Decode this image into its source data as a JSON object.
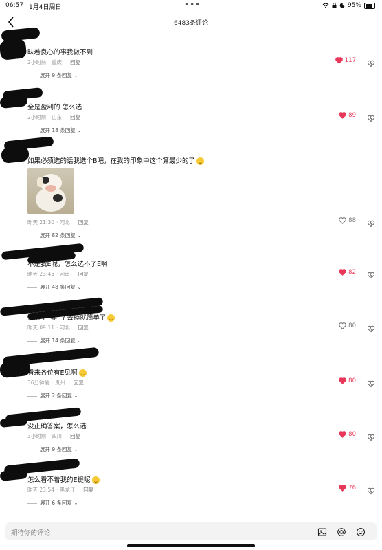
{
  "status": {
    "time": "06:57",
    "date": "1月4日周日",
    "battery": "95%"
  },
  "header": {
    "title": "6483条评论"
  },
  "comments": [
    {
      "text": "昧着良心的事我做不到",
      "time": "2小时前",
      "loc": "重庆",
      "reply": "回复",
      "likes": "117",
      "liked": true,
      "expand": "展开 9 条回复"
    },
    {
      "text": "全是盈利的 怎么选",
      "time": "2小时前",
      "loc": "山东",
      "reply": "回复",
      "likes": "89",
      "liked": true,
      "expand": "展开 18 条回复"
    },
    {
      "text": "如果必须选的话我选个B吧，在我的印象中这个算最少的了",
      "time": "昨天 21:30",
      "loc": "河北",
      "reply": "回复",
      "likes": "88",
      "liked": false,
      "expand": "展开 82 条回复"
    },
    {
      "text": "不是我E呢，怎么选不了E啊",
      "time": "昨天 23:45",
      "loc": "河南",
      "reply": "回复",
      "likes": "82",
      "liked": true,
      "expand": "展开 48 条回复"
    },
    {
      "text": "把那个“非”字去掉就简单了",
      "time": "昨天 09:11",
      "loc": "河北",
      "reply": "回复",
      "likes": "80",
      "liked": false,
      "expand": "展开 14 条回复"
    },
    {
      "text": "看来各位有E见啊",
      "time": "36分钟前",
      "loc": "贵州",
      "reply": "回复",
      "likes": "80",
      "liked": true,
      "expand": "展开 2 条回复"
    },
    {
      "text": "没正确答案，怎么选",
      "time": "3小时前",
      "loc": "四川",
      "reply": "回复",
      "likes": "80",
      "liked": true,
      "expand": "展开 9 条回复"
    },
    {
      "text": "怎么看不着我的E键呢",
      "time": "昨天 23:54",
      "loc": "黑龙江",
      "reply": "回复",
      "likes": "76",
      "liked": true,
      "expand": "展开 6 条回复"
    }
  ],
  "input": {
    "placeholder": "期待你的评论"
  },
  "icons": {
    "back": "back-arrow-icon",
    "heart": "heart-icon",
    "dislike": "dislike-icon",
    "image": "image-icon",
    "at": "at-icon",
    "emoji": "emoji-icon"
  },
  "colors": {
    "liked": "#e8385a",
    "muted": "#9a9a9a"
  }
}
